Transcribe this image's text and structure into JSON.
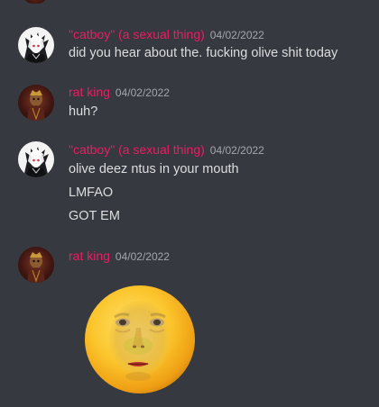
{
  "messages": [
    {
      "username": "\"catboy\" (a sexual thing)",
      "timestamp": "04/02/2022",
      "avatar_icon": "anime-white-hair-avatar-icon",
      "lines": [
        "did you hear about the. fucking olive shit today"
      ]
    },
    {
      "username": "rat king",
      "timestamp": "04/02/2022",
      "avatar_icon": "dark-red-figure-avatar-icon",
      "lines": [
        "huh?"
      ]
    },
    {
      "username": "\"catboy\" (a sexual thing)",
      "timestamp": "04/02/2022",
      "avatar_icon": "anime-white-hair-avatar-icon",
      "lines": [
        "olive deez ntus in your mouth",
        "LMFAO",
        "GOT EM"
      ]
    },
    {
      "username": "rat king",
      "timestamp": "04/02/2022",
      "avatar_icon": "dark-red-figure-avatar-icon",
      "lines": [],
      "attachment": "yellow-moon-face-sticker"
    }
  ],
  "colors": {
    "background": "#36393f",
    "username": "#e91e63",
    "timestamp": "#a3a6aa",
    "message_text": "#dcddde"
  }
}
